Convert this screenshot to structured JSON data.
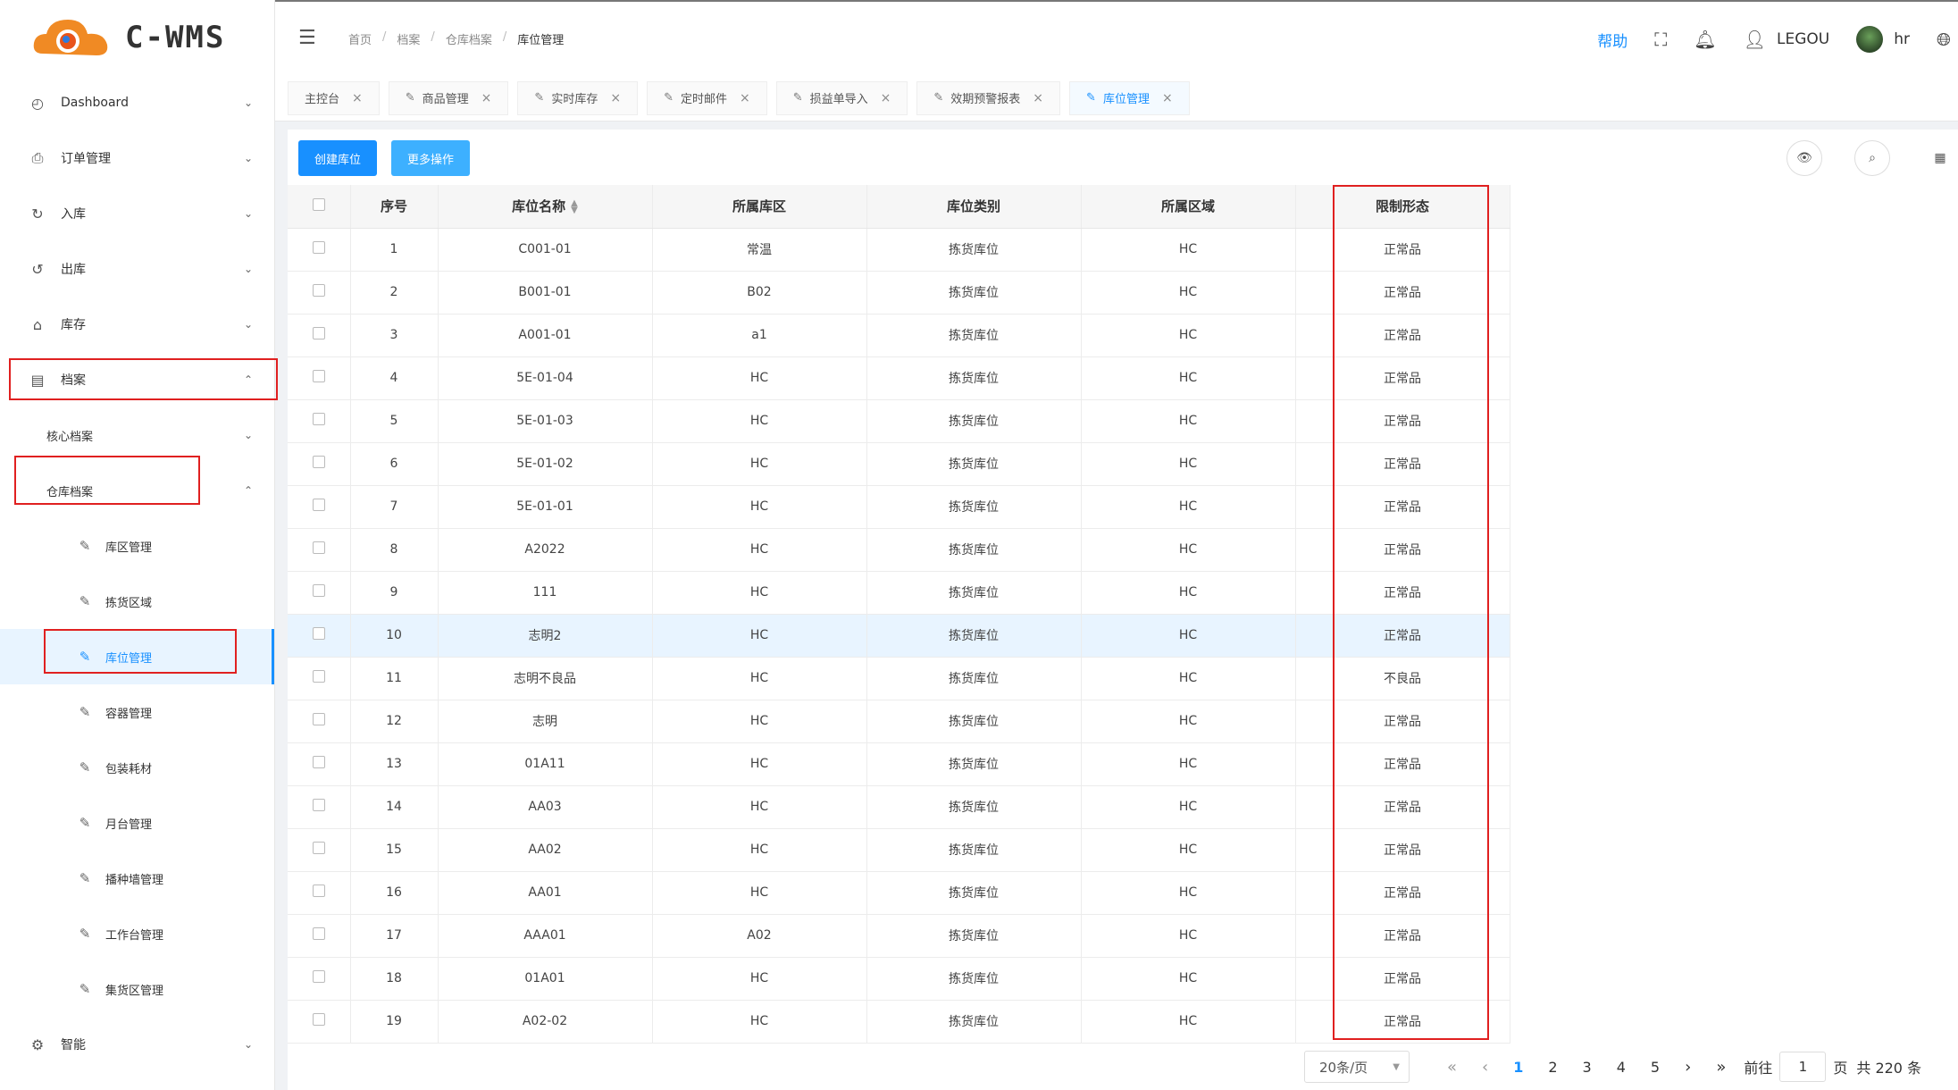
{
  "brand": {
    "logo_text": "C-WMS"
  },
  "sidebar": {
    "items": [
      {
        "label": "Dashboard",
        "icon": "dashboard-icon"
      },
      {
        "label": "订单管理",
        "icon": "order-icon"
      },
      {
        "label": "入库",
        "icon": "inbound-icon"
      },
      {
        "label": "出库",
        "icon": "outbound-icon"
      },
      {
        "label": "库存",
        "icon": "inventory-icon"
      },
      {
        "label": "档案",
        "icon": "archive-icon"
      }
    ],
    "sub_core": "核心档案",
    "sub_warehouse": "仓库档案",
    "leaves": [
      {
        "label": "库区管理"
      },
      {
        "label": "拣货区域"
      },
      {
        "label": "库位管理"
      },
      {
        "label": "容器管理"
      },
      {
        "label": "包装耗材"
      },
      {
        "label": "月台管理"
      },
      {
        "label": "播种墙管理"
      },
      {
        "label": "工作台管理"
      },
      {
        "label": "集货区管理"
      }
    ],
    "last_item": {
      "label": "智能",
      "icon": "smart-icon"
    }
  },
  "header": {
    "breadcrumb": [
      "首页",
      "档案",
      "仓库档案",
      "库位管理"
    ],
    "help": "帮助",
    "company": "LEGOU",
    "user": "hr"
  },
  "tags": [
    {
      "label": "主控台",
      "has_icon": false
    },
    {
      "label": "商品管理",
      "has_icon": true
    },
    {
      "label": "实时库存",
      "has_icon": true
    },
    {
      "label": "定时邮件",
      "has_icon": true
    },
    {
      "label": "损益单导入",
      "has_icon": true
    },
    {
      "label": "效期预警报表",
      "has_icon": true
    },
    {
      "label": "库位管理",
      "has_icon": true,
      "active": true
    }
  ],
  "toolbar": {
    "create_label": "创建库位",
    "more_label": "更多操作"
  },
  "table": {
    "columns": [
      "序号",
      "库位名称",
      "所属库区",
      "库位类别",
      "所属区域",
      "限制形态"
    ],
    "rows": [
      [
        "1",
        "C001-01",
        "常温",
        "拣货库位",
        "HC",
        "正常品"
      ],
      [
        "2",
        "B001-01",
        "B02",
        "拣货库位",
        "HC",
        "正常品"
      ],
      [
        "3",
        "A001-01",
        "a1",
        "拣货库位",
        "HC",
        "正常品"
      ],
      [
        "4",
        "5E-01-04",
        "HC",
        "拣货库位",
        "HC",
        "正常品"
      ],
      [
        "5",
        "5E-01-03",
        "HC",
        "拣货库位",
        "HC",
        "正常品"
      ],
      [
        "6",
        "5E-01-02",
        "HC",
        "拣货库位",
        "HC",
        "正常品"
      ],
      [
        "7",
        "5E-01-01",
        "HC",
        "拣货库位",
        "HC",
        "正常品"
      ],
      [
        "8",
        "A2022",
        "HC",
        "拣货库位",
        "HC",
        "正常品"
      ],
      [
        "9",
        "111",
        "HC",
        "拣货库位",
        "HC",
        "正常品"
      ],
      [
        "10",
        "志明2",
        "HC",
        "拣货库位",
        "HC",
        "正常品"
      ],
      [
        "11",
        "志明不良品",
        "HC",
        "拣货库位",
        "HC",
        "不良品"
      ],
      [
        "12",
        "志明",
        "HC",
        "拣货库位",
        "HC",
        "正常品"
      ],
      [
        "13",
        "01A11",
        "HC",
        "拣货库位",
        "HC",
        "正常品"
      ],
      [
        "14",
        "AA03",
        "HC",
        "拣货库位",
        "HC",
        "正常品"
      ],
      [
        "15",
        "AA02",
        "HC",
        "拣货库位",
        "HC",
        "正常品"
      ],
      [
        "16",
        "AA01",
        "HC",
        "拣货库位",
        "HC",
        "正常品"
      ],
      [
        "17",
        "AAA01",
        "A02",
        "拣货库位",
        "HC",
        "正常品"
      ],
      [
        "18",
        "01A01",
        "HC",
        "拣货库位",
        "HC",
        "正常品"
      ],
      [
        "19",
        "A02-02",
        "HC",
        "拣货库位",
        "HC",
        "正常品"
      ]
    ],
    "highlighted_row": 10
  },
  "pagination": {
    "page_size": "20条/页",
    "pages": [
      "1",
      "2",
      "3",
      "4",
      "5"
    ],
    "current": "1",
    "goto_prefix": "前往",
    "goto_value": "1",
    "goto_suffix": "页",
    "total": "共 220 条"
  },
  "colors": {
    "accent": "#1890ff",
    "highlight_box": "#e02020"
  }
}
